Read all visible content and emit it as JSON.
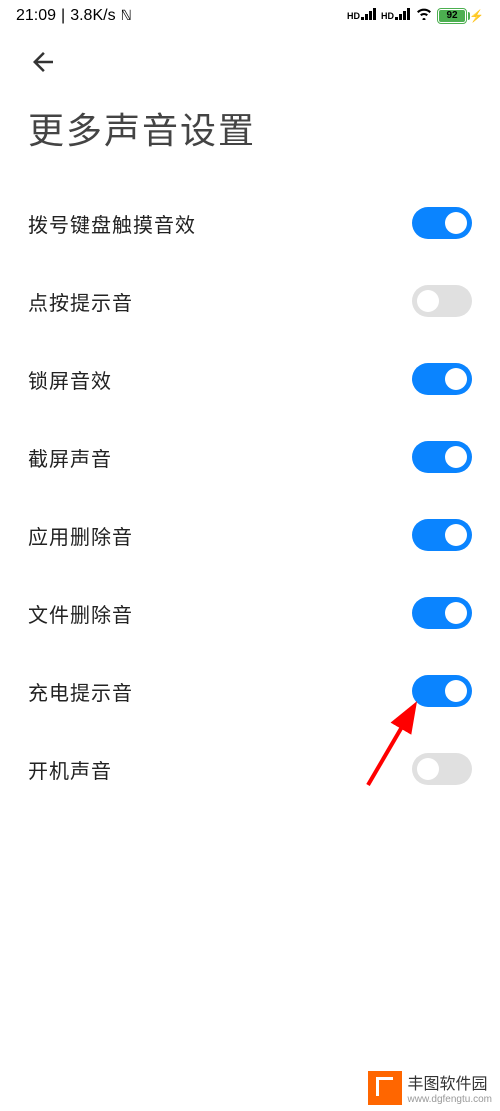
{
  "status_bar": {
    "time": "21:09",
    "network_speed": "3.8K/s",
    "signal1_label": "HD",
    "signal2_label": "HD",
    "battery_level": "92"
  },
  "page": {
    "title": "更多声音设置"
  },
  "settings": [
    {
      "label": "拨号键盘触摸音效",
      "on": true
    },
    {
      "label": "点按提示音",
      "on": false
    },
    {
      "label": "锁屏音效",
      "on": true
    },
    {
      "label": "截屏声音",
      "on": true
    },
    {
      "label": "应用删除音",
      "on": true
    },
    {
      "label": "文件删除音",
      "on": true
    },
    {
      "label": "充电提示音",
      "on": true
    },
    {
      "label": "开机声音",
      "on": false
    }
  ],
  "watermark": {
    "title": "丰图软件园",
    "url": "www.dgfengtu.com"
  },
  "colors": {
    "accent": "#0a84ff",
    "toggle_off": "#e0e0e0",
    "battery": "#4caf50",
    "arrow": "#ff0000",
    "brand": "#ff6600"
  }
}
